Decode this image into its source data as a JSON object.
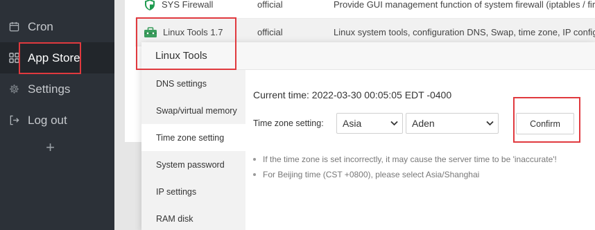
{
  "sidebar": {
    "items": [
      {
        "label": "Cron",
        "icon": "calendar-icon"
      },
      {
        "label": "App Store",
        "icon": "grid-icon"
      },
      {
        "label": "Settings",
        "icon": "gear-icon"
      },
      {
        "label": "Log out",
        "icon": "logout-icon"
      }
    ],
    "add_label": "+"
  },
  "table": {
    "rows": [
      {
        "name": "SYS Firewall",
        "type": "official",
        "desc": "Provide GUI management function of system firewall (iptables / fir"
      },
      {
        "name": "Linux Tools 1.7",
        "type": "official",
        "desc": "Linux system tools, configuration DNS, Swap, time zone, IP configu"
      }
    ]
  },
  "modal": {
    "title": "Linux Tools",
    "tabs": [
      {
        "label": "DNS settings"
      },
      {
        "label": "Swap/virtual memory"
      },
      {
        "label": "Time zone setting"
      },
      {
        "label": "System password"
      },
      {
        "label": "IP settings"
      },
      {
        "label": "RAM disk"
      }
    ],
    "current_time": "Current time: 2022-03-30 00:05:05 EDT -0400",
    "tz_label": "Time zone setting:",
    "region": "Asia",
    "city": "Aden",
    "confirm_label": "Confirm",
    "tips": [
      "If the time zone is set incorrectly, it may cause the server time to be 'inaccurate'!",
      "For Beijing time (CST +0800), please select Asia/Shanghai"
    ]
  },
  "colors": {
    "sidebar_bg": "#2c3138",
    "highlight_red": "#e0393e"
  }
}
